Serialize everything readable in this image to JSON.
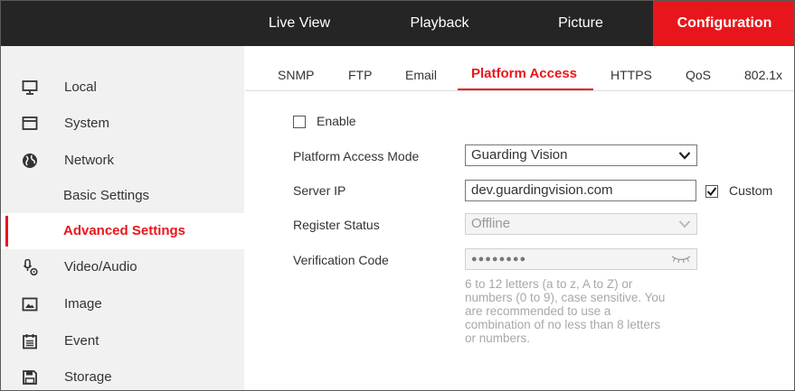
{
  "topnav": {
    "items": [
      {
        "label": "Live View"
      },
      {
        "label": "Playback"
      },
      {
        "label": "Picture"
      },
      {
        "label": "Configuration"
      }
    ]
  },
  "sidebar": {
    "items": [
      {
        "label": "Local",
        "icon": "monitor-icon"
      },
      {
        "label": "System",
        "icon": "window-icon"
      },
      {
        "label": "Network",
        "icon": "globe-icon"
      },
      {
        "label": "Basic Settings"
      },
      {
        "label": "Advanced Settings"
      },
      {
        "label": "Video/Audio",
        "icon": "microphone-camera-icon"
      },
      {
        "label": "Image",
        "icon": "image-icon"
      },
      {
        "label": "Event",
        "icon": "calendar-icon"
      },
      {
        "label": "Storage",
        "icon": "floppy-disk-icon"
      }
    ]
  },
  "tabs": [
    {
      "label": "SNMP"
    },
    {
      "label": "FTP"
    },
    {
      "label": "Email"
    },
    {
      "label": "Platform Access"
    },
    {
      "label": "HTTPS"
    },
    {
      "label": "QoS"
    },
    {
      "label": "802.1x"
    }
  ],
  "form": {
    "enable_label": "Enable",
    "enable_checked": false,
    "mode_label": "Platform Access Mode",
    "mode_value": "Guarding Vision",
    "server_ip_label": "Server IP",
    "server_ip_value": "dev.guardingvision.com",
    "custom_label": "Custom",
    "custom_checked": true,
    "register_status_label": "Register Status",
    "register_status_value": "Offline",
    "verification_label": "Verification Code",
    "verification_value": "●●●●●●●●",
    "hint_line1": "6 to 12 letters (a to z, A to Z) or",
    "hint_line2": "numbers (0 to 9), case sensitive. You",
    "hint_line3": "are recommended to use a",
    "hint_line4": "combination of no less than 8 letters",
    "hint_line5": "or numbers."
  },
  "colors": {
    "accent": "#e8161c",
    "topbar": "#252525",
    "sidebar": "#f1f1f1"
  }
}
